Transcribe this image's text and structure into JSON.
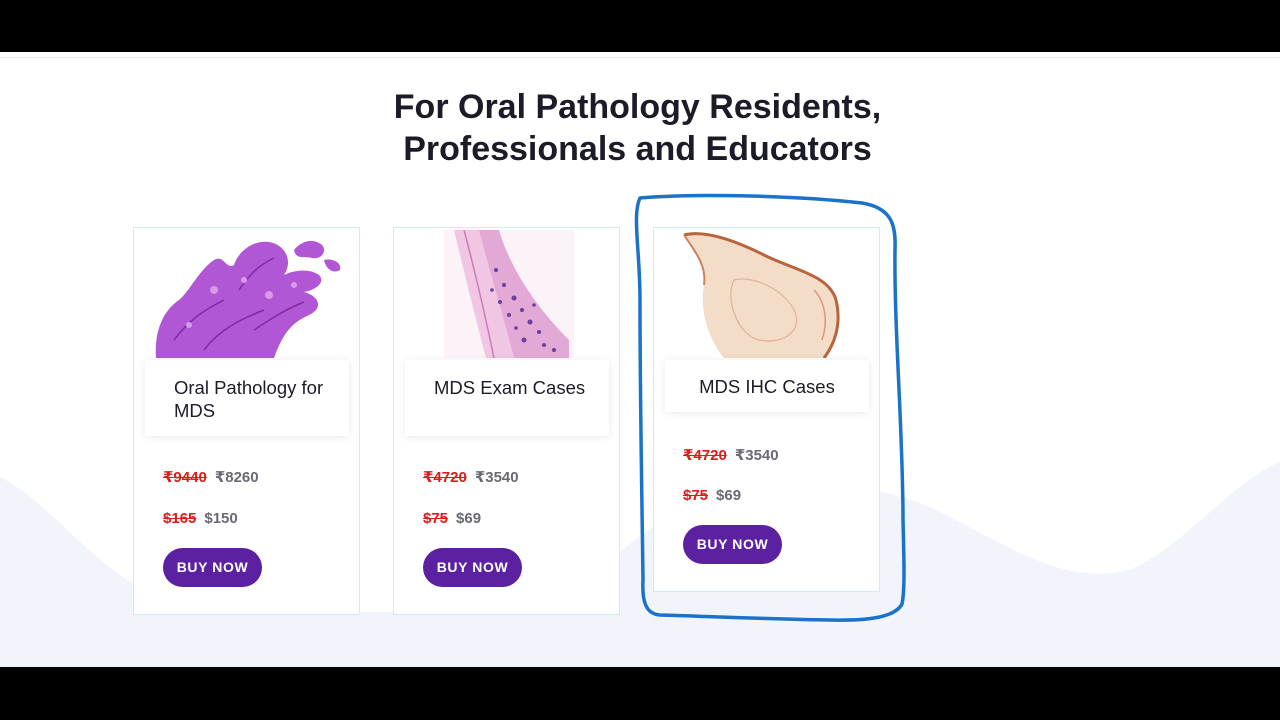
{
  "page": {
    "heading": "For Oral Pathology Residents,\nProfessionals and Educators"
  },
  "colors": {
    "accent": "#5b21a0",
    "strike_price": "#e01b1b",
    "card_border": "#cbeef3",
    "annotation": "#1a73c8"
  },
  "cards": [
    {
      "title": "Oral Pathology for MDS",
      "image": "purple-he-stained-papillary-tissue",
      "inr_old": "₹9440",
      "inr_new": "₹8260",
      "usd_old": "$165",
      "usd_new": "$150",
      "button": "BUY NOW"
    },
    {
      "title": "MDS Exam Cases",
      "image": "pink-he-stained-tissue-strip",
      "inr_old": "₹4720",
      "inr_new": "₹3540",
      "usd_old": "$75",
      "usd_new": "$69",
      "button": "BUY NOW"
    },
    {
      "title": "MDS IHC Cases",
      "image": "brown-ihc-stained-tissue",
      "inr_old": "₹4720",
      "inr_new": "₹3540",
      "usd_old": "$75",
      "usd_new": "$69",
      "button": "BUY NOW"
    }
  ]
}
